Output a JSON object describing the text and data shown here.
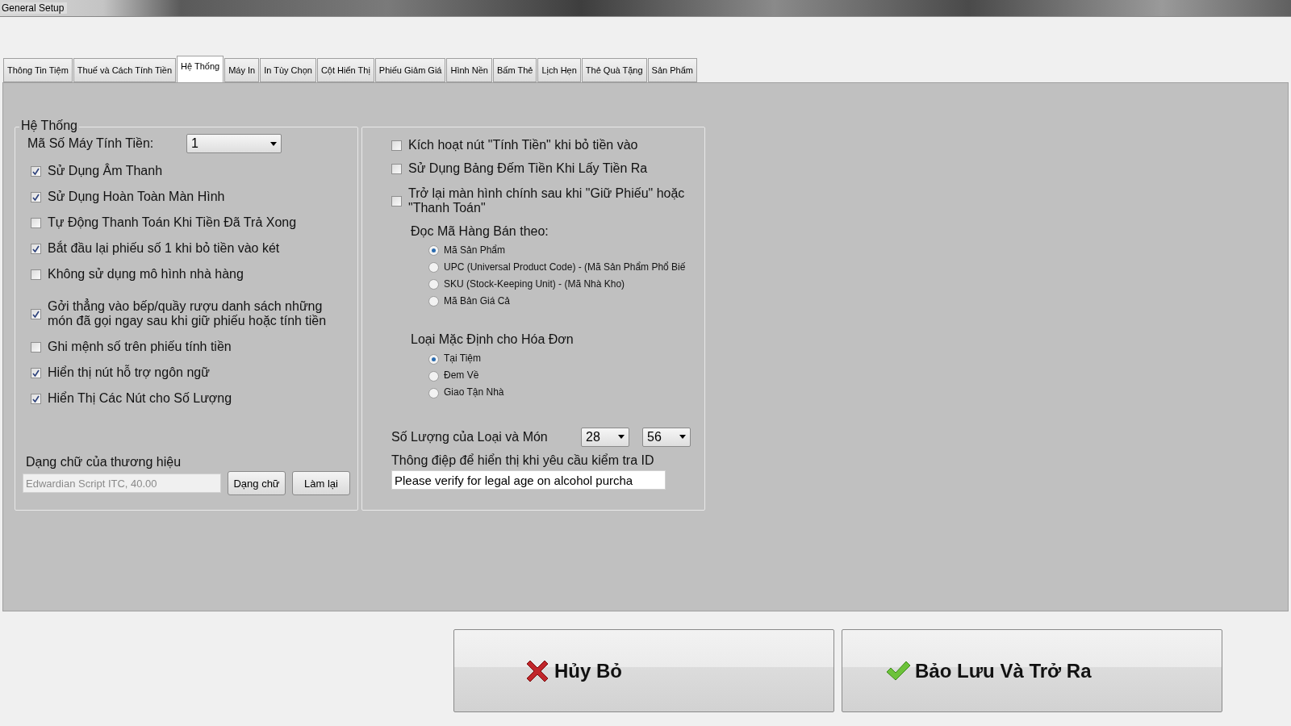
{
  "window": {
    "title": "General Setup"
  },
  "tabs": [
    {
      "label": "Thông Tin Tiệm",
      "selected": false
    },
    {
      "label": "Thuế và Cách Tính Tiền",
      "selected": false
    },
    {
      "label": "Hệ Thống",
      "selected": true
    },
    {
      "label": "Máy In",
      "selected": false
    },
    {
      "label": "In Tùy Chọn",
      "selected": false
    },
    {
      "label": "Cột Hiển Thị",
      "selected": false
    },
    {
      "label": "Phiếu Giảm Giá",
      "selected": false
    },
    {
      "label": "Hình Nền",
      "selected": false
    },
    {
      "label": "Bấm Thẻ",
      "selected": false
    },
    {
      "label": "Lịch Hẹn",
      "selected": false
    },
    {
      "label": "Thẻ Quà Tặng",
      "selected": false
    },
    {
      "label": "Sản Phẩm",
      "selected": false
    }
  ],
  "left_group": {
    "title": "Hệ Thống",
    "register_label": "Mã Số Máy Tính Tiền:",
    "register_value": "1",
    "checkboxes": [
      {
        "label": "Sử Dụng Âm Thanh",
        "checked": true
      },
      {
        "label": "Sử Dụng Hoàn Toàn Màn Hình",
        "checked": true
      },
      {
        "label": "Tự Động Thanh Toán Khi Tiền Đã Trả Xong",
        "checked": false
      },
      {
        "label": "Bắt đầu lại phiếu số 1 khi bỏ tiền vào két",
        "checked": true
      },
      {
        "label": "Không sử dụng mô hình nhà hàng",
        "checked": false
      },
      {
        "label": "Gởi thẳng vào bếp/quầy rượu danh sách những\nmón đã gọi ngay sau khi giữ phiếu hoặc tính tiền",
        "checked": true
      },
      {
        "label": "Ghi mệnh số trên phiếu tính tiền",
        "checked": false
      },
      {
        "label": "Hiển thị nút hỗ trợ ngôn ngữ",
        "checked": true
      },
      {
        "label": "Hiển Thị Các Nút cho Số Lượng",
        "checked": true
      }
    ],
    "brand_font": {
      "label": "Dạng chữ của thương hiệu",
      "value": "Edwardian Script ITC, 40.00",
      "buttons": [
        "Dạng chữ",
        "Làm lại"
      ]
    }
  },
  "right_group": {
    "checkboxes": [
      {
        "label": "Kích hoạt nút \"Tính Tiền\" khi bỏ tiền vào",
        "checked": false
      },
      {
        "label": "Sử Dụng Bảng Đếm Tiền Khi Lấy Tiền Ra",
        "checked": false
      },
      {
        "label": "Trở lại màn hình chính sau khi \"Giữ Phiếu\" hoặc\n\"Thanh Toán\"",
        "checked": false
      }
    ],
    "radio_groups": [
      {
        "title": "Đọc Mã Hàng Bán theo:",
        "options": [
          {
            "label": "Mã Sản Phẩm",
            "selected": true
          },
          {
            "label": "UPC (Universal Product Code) - (Mã Sản Phẩm Phổ Biế",
            "selected": false
          },
          {
            "label": "SKU (Stock-Keeping Unit) - (Mã Nhà Kho)",
            "selected": false
          },
          {
            "label": "Mã Bản Giá Cả",
            "selected": false
          }
        ]
      },
      {
        "title": "Loại Mặc Định cho Hóa Đơn",
        "options": [
          {
            "label": "Tại Tiệm",
            "selected": true
          },
          {
            "label": "Đem Về",
            "selected": false
          },
          {
            "label": "Giao Tận Nhà",
            "selected": false
          }
        ]
      }
    ],
    "quantity": {
      "label": "Số Lượng của Loại và Món",
      "values": [
        "28",
        "56"
      ]
    },
    "id_message": {
      "label": "Thông điệp để hiển thị khi yêu cầu kiểm tra ID",
      "value": "Please verify for legal age on alcohol purcha"
    }
  },
  "buttons": [
    {
      "label": "Hủy Bỏ",
      "kind": "cancel"
    },
    {
      "label": "Bảo Lưu Và Trở Ra",
      "kind": "save"
    }
  ]
}
